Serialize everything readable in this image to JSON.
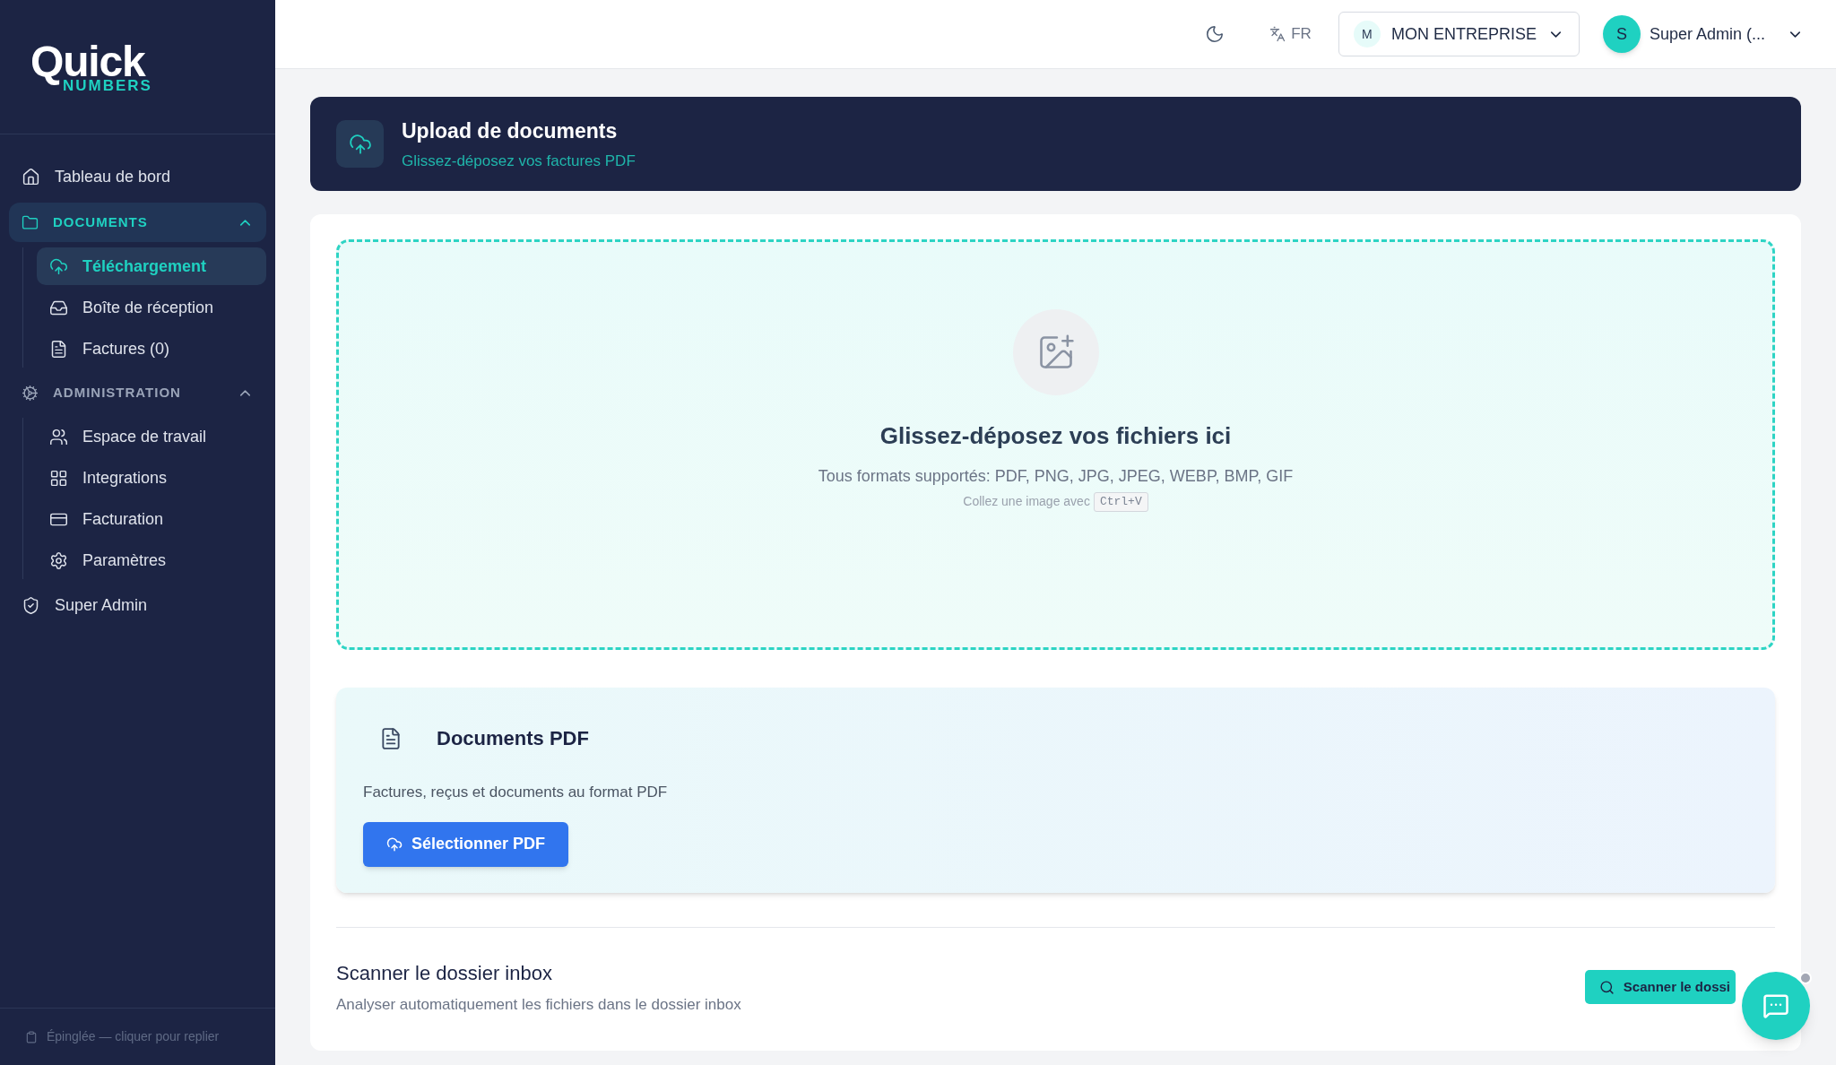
{
  "logo": {
    "word": "Quick",
    "subword": "NUMBERS"
  },
  "sidebar": {
    "items": [
      {
        "kind": "link",
        "label": "Tableau de bord",
        "selected": false
      },
      {
        "kind": "group",
        "label": "DOCUMENTS",
        "selected": true,
        "expanded": true,
        "children": [
          {
            "label": "Téléchargement",
            "selected": true
          },
          {
            "label": "Boîte de réception",
            "selected": false
          },
          {
            "label": "Factures (0)",
            "selected": false
          }
        ]
      },
      {
        "kind": "group",
        "label": "ADMINISTRATION",
        "selected": false,
        "expanded": true,
        "children": [
          {
            "label": "Espace de travail",
            "selected": false
          },
          {
            "label": "Integrations",
            "selected": false
          },
          {
            "label": "Facturation",
            "selected": false
          },
          {
            "label": "Paramètres",
            "selected": false
          }
        ]
      },
      {
        "kind": "link",
        "label": "Super Admin",
        "selected": false
      }
    ],
    "footer": "Épinglée — cliquer pour replier"
  },
  "header": {
    "language": "FR",
    "company": {
      "initial": "M",
      "name": "MON ENTREPRISE"
    },
    "user": {
      "initial": "S",
      "name": "Super Admin (..."
    }
  },
  "banner": {
    "title": "Upload de documents",
    "subtitle": "Glissez-déposez vos factures PDF"
  },
  "dropzone": {
    "title": "Glissez-déposez vos fichiers ici",
    "formats": "Tous formats supportés: PDF, PNG, JPG, JPEG, WEBP, BMP, GIF",
    "paste_hint": "Collez une image avec",
    "shortcut": "Ctrl+V"
  },
  "pdf_card": {
    "title": "Documents PDF",
    "description": "Factures, reçus et documents au format PDF",
    "button": "Sélectionner PDF"
  },
  "scan": {
    "title": "Scanner le dossier inbox",
    "description": "Analyser automatiquement les fichiers dans le dossier inbox",
    "button": "Scanner le dossi"
  },
  "chat": {
    "notification": true
  }
}
